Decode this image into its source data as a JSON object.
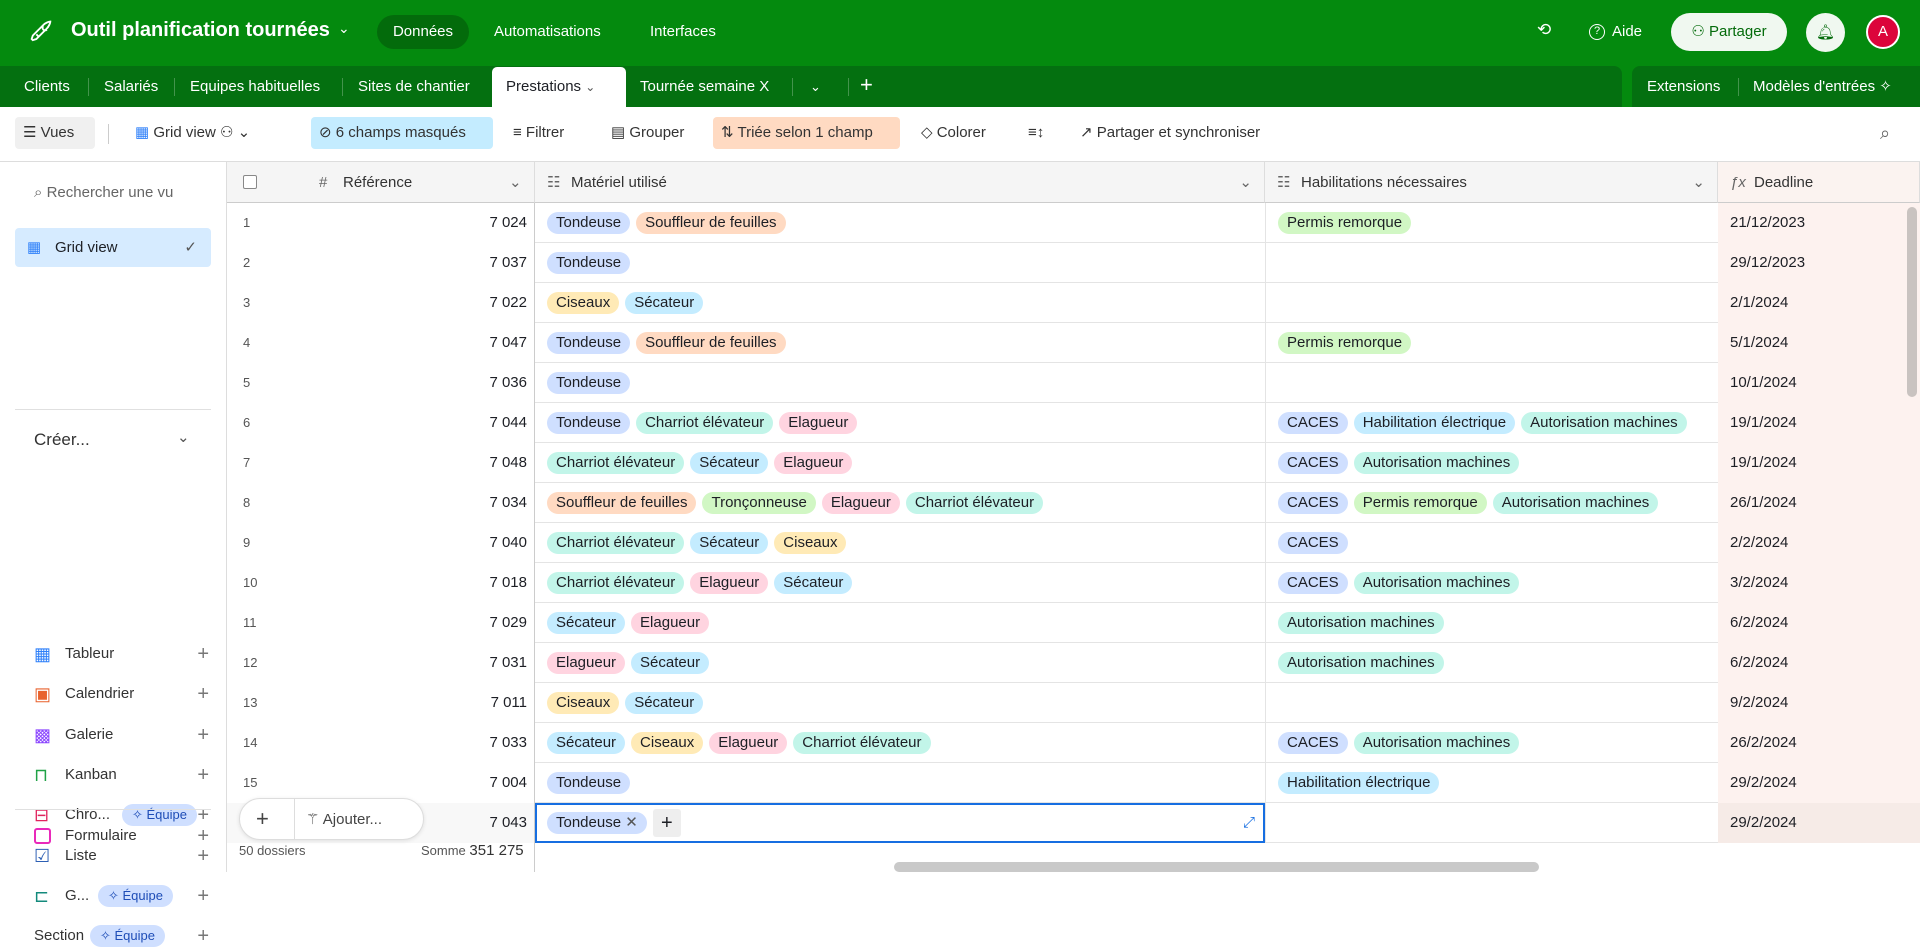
{
  "app": {
    "title": "Outil planification tournées",
    "nav": [
      "Données",
      "Automatisations",
      "Interfaces"
    ],
    "help": "Aide",
    "share": "Partager",
    "avatar": "A"
  },
  "tabs": [
    "Clients",
    "Salariés",
    "Equipes habituelles",
    "Sites de chantier",
    "Prestations",
    "Tournée semaine X"
  ],
  "tabs_right": {
    "extensions": "Extensions",
    "templates": "Modèles d'entrées"
  },
  "toolbar": {
    "views": "Vues",
    "grid_view": "Grid view",
    "hidden": "6 champs masqués",
    "filter": "Filtrer",
    "group": "Grouper",
    "sort": "Triée selon 1 champ",
    "color": "Colorer",
    "share_sync": "Partager et synchroniser"
  },
  "sidebar": {
    "search_placeholder": "Rechercher une vu",
    "current_view": "Grid view",
    "create": "Créer...",
    "items": [
      {
        "label": "Tableur",
        "badge": null
      },
      {
        "label": "Calendrier",
        "badge": null
      },
      {
        "label": "Galerie",
        "badge": null
      },
      {
        "label": "Kanban",
        "badge": null
      },
      {
        "label": "Chro...",
        "badge": "Équipe"
      },
      {
        "label": "Liste",
        "badge": null
      },
      {
        "label": "G...",
        "badge": "Équipe"
      },
      {
        "label": "Section",
        "badge": "Équipe"
      }
    ],
    "form": "Formulaire"
  },
  "columns": {
    "reference": "Référence",
    "materiel": "Matériel utilisé",
    "habilitations": "Habilitations nécessaires",
    "deadline": "Deadline"
  },
  "palette": {
    "Tondeuse": "#cfdfff",
    "Souffleur de feuilles": "#ffdac2",
    "Ciseaux": "#ffeab6",
    "Sécateur": "#c4ecff",
    "Charriot élévateur": "#c2f5e9",
    "Elagueur": "#ffd4e0",
    "Tronçonneuse": "#d1f7c4",
    "Permis remorque": "#d1f7c4",
    "CACES": "#cfdfff",
    "Habilitation électrique": "#c4ecff",
    "Autorisation machines": "#c2f5e9"
  },
  "rows": [
    {
      "n": "1",
      "ref": "7 024",
      "mat": [
        "Tondeuse",
        "Souffleur de feuilles"
      ],
      "hab": [
        "Permis remorque"
      ],
      "deadline": "21/12/2023"
    },
    {
      "n": "2",
      "ref": "7 037",
      "mat": [
        "Tondeuse"
      ],
      "hab": [],
      "deadline": "29/12/2023"
    },
    {
      "n": "3",
      "ref": "7 022",
      "mat": [
        "Ciseaux",
        "Sécateur"
      ],
      "hab": [],
      "deadline": "2/1/2024"
    },
    {
      "n": "4",
      "ref": "7 047",
      "mat": [
        "Tondeuse",
        "Souffleur de feuilles"
      ],
      "hab": [
        "Permis remorque"
      ],
      "deadline": "5/1/2024"
    },
    {
      "n": "5",
      "ref": "7 036",
      "mat": [
        "Tondeuse"
      ],
      "hab": [],
      "deadline": "10/1/2024"
    },
    {
      "n": "6",
      "ref": "7 044",
      "mat": [
        "Tondeuse",
        "Charriot élévateur",
        "Elagueur"
      ],
      "hab": [
        "CACES",
        "Habilitation électrique",
        "Autorisation machines"
      ],
      "deadline": "19/1/2024"
    },
    {
      "n": "7",
      "ref": "7 048",
      "mat": [
        "Charriot élévateur",
        "Sécateur",
        "Elagueur"
      ],
      "hab": [
        "CACES",
        "Autorisation machines"
      ],
      "deadline": "19/1/2024"
    },
    {
      "n": "8",
      "ref": "7 034",
      "mat": [
        "Souffleur de feuilles",
        "Tronçonneuse",
        "Elagueur",
        "Charriot élévateur"
      ],
      "hab": [
        "CACES",
        "Permis remorque",
        "Autorisation machines"
      ],
      "deadline": "26/1/2024"
    },
    {
      "n": "9",
      "ref": "7 040",
      "mat": [
        "Charriot élévateur",
        "Sécateur",
        "Ciseaux"
      ],
      "hab": [
        "CACES"
      ],
      "deadline": "2/2/2024"
    },
    {
      "n": "10",
      "ref": "7 018",
      "mat": [
        "Charriot élévateur",
        "Elagueur",
        "Sécateur"
      ],
      "hab": [
        "CACES",
        "Autorisation machines"
      ],
      "deadline": "3/2/2024"
    },
    {
      "n": "11",
      "ref": "7 029",
      "mat": [
        "Sécateur",
        "Elagueur"
      ],
      "hab": [
        "Autorisation machines"
      ],
      "deadline": "6/2/2024"
    },
    {
      "n": "12",
      "ref": "7 031",
      "mat": [
        "Elagueur",
        "Sécateur"
      ],
      "hab": [
        "Autorisation machines"
      ],
      "deadline": "6/2/2024"
    },
    {
      "n": "13",
      "ref": "7 011",
      "mat": [
        "Ciseaux",
        "Sécateur"
      ],
      "hab": [],
      "deadline": "9/2/2024"
    },
    {
      "n": "14",
      "ref": "7 033",
      "mat": [
        "Sécateur",
        "Ciseaux",
        "Elagueur",
        "Charriot élévateur"
      ],
      "hab": [
        "CACES",
        "Autorisation machines"
      ],
      "deadline": "26/2/2024"
    },
    {
      "n": "15",
      "ref": "7 004",
      "mat": [
        "Tondeuse"
      ],
      "hab": [
        "Habilitation électrique"
      ],
      "deadline": "29/2/2024"
    },
    {
      "n": "",
      "ref": "7 043",
      "mat": [
        "Tondeuse"
      ],
      "hab": [],
      "deadline": "29/2/2024",
      "editing": true
    }
  ],
  "add_menu": {
    "add_label": "Ajouter..."
  },
  "footer": {
    "count": "50 dossiers",
    "sum_label": "Somme",
    "sum": "351 275"
  }
}
